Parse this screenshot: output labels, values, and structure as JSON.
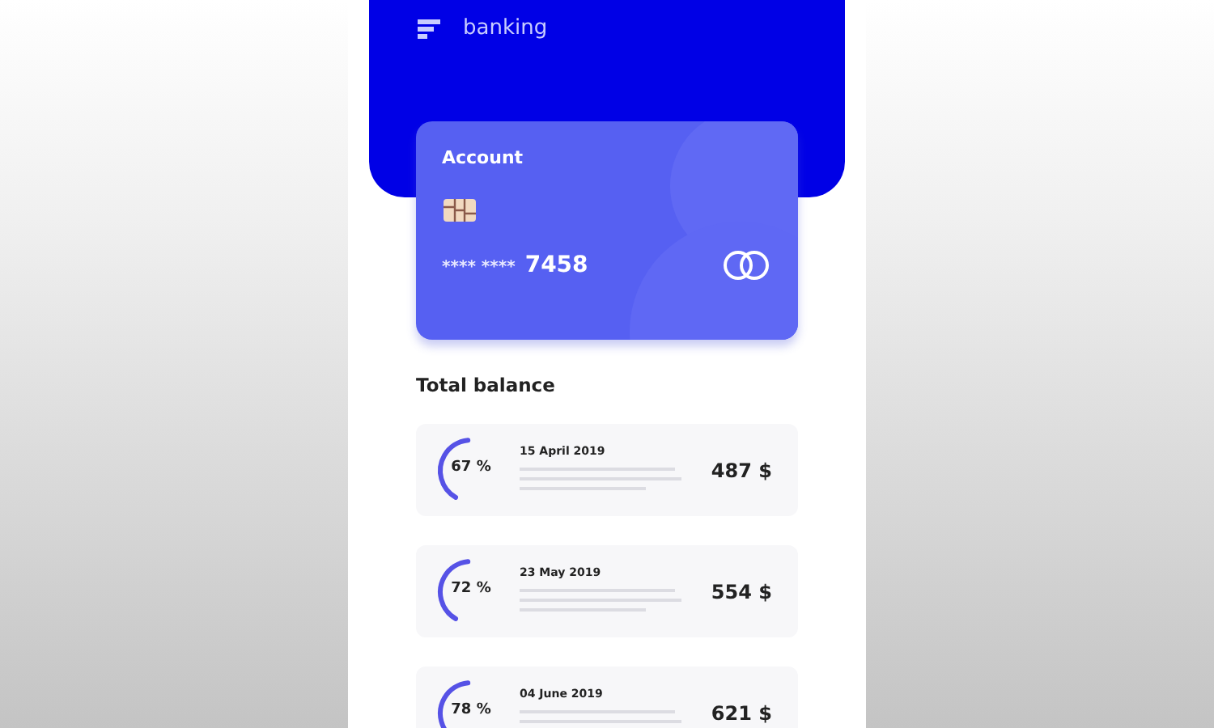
{
  "header": {
    "app_name": "banking"
  },
  "card": {
    "title": "Account",
    "number_mask": "**** ****",
    "number_last": "7458"
  },
  "section_title": "Total balance",
  "transactions": [
    {
      "percent": "67 %",
      "date": "15 April 2019",
      "amount": "487 $"
    },
    {
      "percent": "72 %",
      "date": "23 May 2019",
      "amount": "554 $"
    },
    {
      "percent": "78 %",
      "date": "04 June 2019",
      "amount": "621 $"
    }
  ]
}
